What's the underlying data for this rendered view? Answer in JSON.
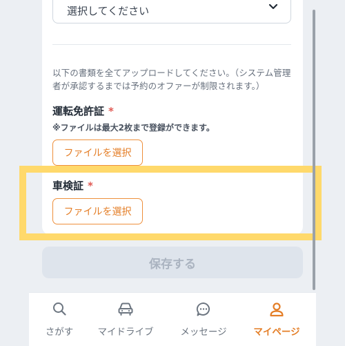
{
  "form": {
    "select_value": "選択してください",
    "instructions": "以下の書類を全てアップロードしてください。（システム管理者が承認するまでは予約のオファーが制限されます。）",
    "documents": [
      {
        "title": "運転免許証",
        "required_mark": "*",
        "note": "※ファイルは最大2枚まで登録ができます。",
        "button_label": "ファイルを選択"
      },
      {
        "title": "車検証",
        "required_mark": "*",
        "button_label": "ファイルを選択"
      }
    ],
    "save_label": "保存する"
  },
  "bottom_nav": {
    "items": [
      {
        "label": "さがす",
        "icon": "search-icon"
      },
      {
        "label": "マイドライブ",
        "icon": "car-icon"
      },
      {
        "label": "メッセージ",
        "icon": "chat-bubble-icon"
      },
      {
        "label": "マイページ",
        "icon": "user-icon",
        "active": true
      }
    ]
  },
  "colors": {
    "accent": "#e47e27",
    "highlight": "#ffd96b",
    "required": "#e05a54",
    "background": "#eceff3"
  }
}
